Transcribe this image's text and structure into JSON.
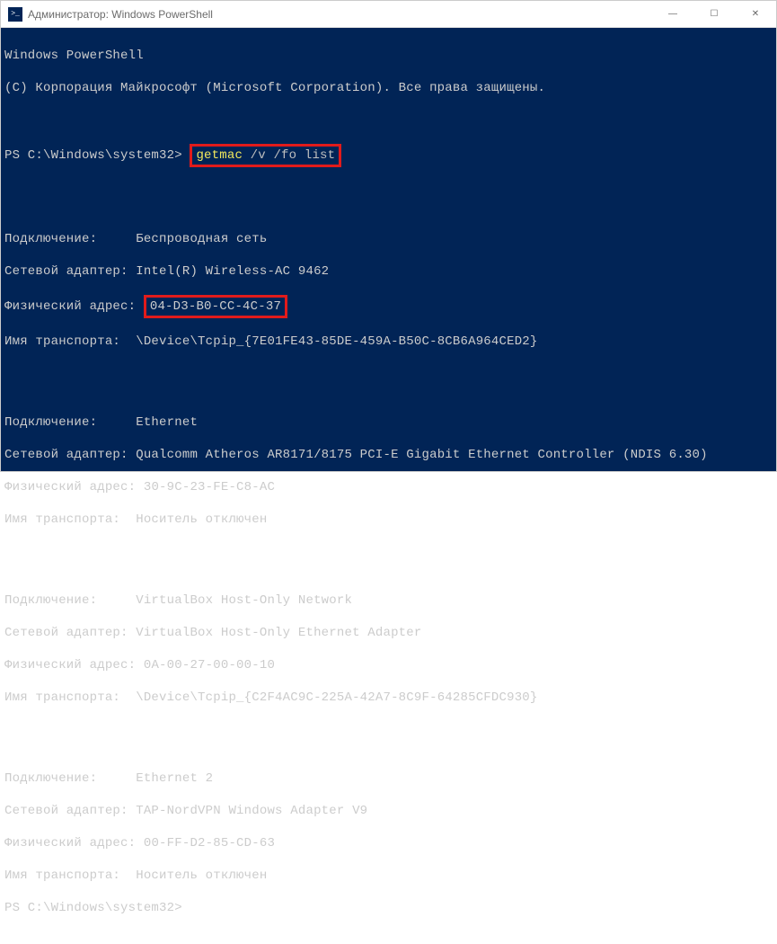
{
  "window": {
    "title": "Администратор: Windows PowerShell"
  },
  "header": {
    "line1": "Windows PowerShell",
    "line2": "(C) Корпорация Майкрософт (Microsoft Corporation). Все права защищены."
  },
  "prompt1": {
    "path": "PS C:\\Windows\\system32> ",
    "cmd_name": "getmac",
    "cmd_args": " /v /fo list"
  },
  "adapters": [
    {
      "conn_label": "Подключение:     ",
      "conn_value": "Беспроводная сеть",
      "net_label": "Сетевой адаптер: ",
      "net_value": "Intel(R) Wireless-AC 9462",
      "phys_label": "Физический адрес:",
      "phys_space": " ",
      "phys_value": "04-D3-B0-CC-4C-37",
      "trans_label": "Имя транспорта:  ",
      "trans_value": "\\Device\\Tcpip_{7E01FE43-85DE-459A-B50C-8CB6A964CED2}",
      "highlight_mac": true
    },
    {
      "conn_label": "Подключение:     ",
      "conn_value": "Ethernet",
      "net_label": "Сетевой адаптер: ",
      "net_value": "Qualcomm Atheros AR8171/8175 PCI-E Gigabit Ethernet Controller (NDIS 6.30)",
      "phys_label": "Физический адрес:",
      "phys_space": " ",
      "phys_value": "30-9C-23-FE-C8-AC",
      "trans_label": "Имя транспорта:  ",
      "trans_value": "Носитель отключен",
      "highlight_mac": false
    },
    {
      "conn_label": "Подключение:     ",
      "conn_value": "VirtualBox Host-Only Network",
      "net_label": "Сетевой адаптер: ",
      "net_value": "VirtualBox Host-Only Ethernet Adapter",
      "phys_label": "Физический адрес:",
      "phys_space": " ",
      "phys_value": "0A-00-27-00-00-10",
      "trans_label": "Имя транспорта:  ",
      "trans_value": "\\Device\\Tcpip_{C2F4AC9C-225A-42A7-8C9F-64285CFDC930}",
      "highlight_mac": false
    },
    {
      "conn_label": "Подключение:     ",
      "conn_value": "Ethernet 2",
      "net_label": "Сетевой адаптер: ",
      "net_value": "TAP-NordVPN Windows Adapter V9",
      "phys_label": "Физический адрес:",
      "phys_space": " ",
      "phys_value": "00-FF-D2-85-CD-63",
      "trans_label": "Имя транспорта:  ",
      "trans_value": "Носитель отключен",
      "highlight_mac": false
    }
  ],
  "prompt2": {
    "path": "PS C:\\Windows\\system32> "
  },
  "controls": {
    "min": "—",
    "max": "☐",
    "close": "✕"
  }
}
